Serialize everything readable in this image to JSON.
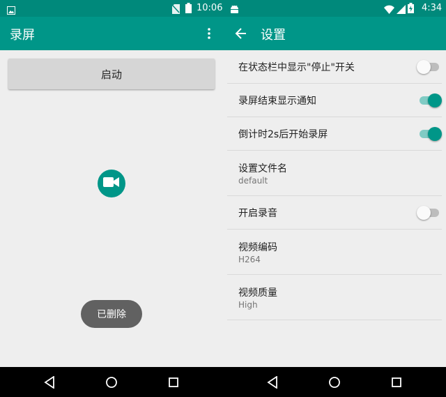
{
  "left_screen": {
    "status_time": "10:06",
    "title": "录屏",
    "start_button_label": "启动",
    "toast_text": "已删除"
  },
  "right_screen": {
    "status_time": "4:34",
    "title": "设置",
    "settings": [
      {
        "label": "在状态栏中显示\"停止\"开关",
        "toggle": "off"
      },
      {
        "label": "录屏结束显示通知",
        "toggle": "on"
      },
      {
        "label": "倒计时2s后开始录屏",
        "toggle": "on"
      },
      {
        "label": "设置文件名",
        "value": "default"
      },
      {
        "label": "开启录音",
        "toggle": "off"
      },
      {
        "label": "视频编码",
        "value": "H264"
      },
      {
        "label": "视频质量",
        "value": "High"
      }
    ]
  },
  "colors": {
    "primary": "#009688",
    "primary_dark": "#00897B",
    "background": "#EEEEEE",
    "toast": "#616161"
  },
  "icons": [
    "image-icon",
    "no-sim-icon",
    "battery-icon",
    "overflow-menu-icon",
    "videocam-icon",
    "android-icon",
    "wifi-icon",
    "signal-icon",
    "battery-charging-icon",
    "back-arrow-icon",
    "nav-back-icon",
    "nav-home-icon",
    "nav-recents-icon"
  ]
}
